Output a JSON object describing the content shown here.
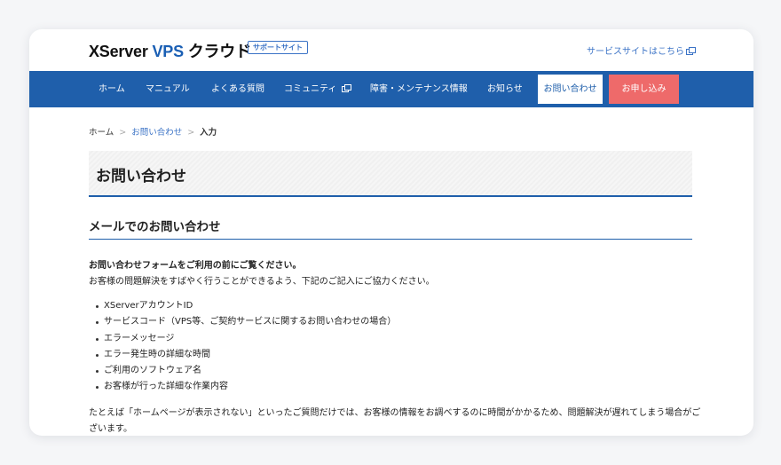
{
  "header": {
    "logo": {
      "part1": "XServer",
      "part2": "VPS",
      "part3": "クラウド"
    },
    "support_badge": "サポートサイト",
    "service_link": "サービスサイトはこちら"
  },
  "nav": {
    "items": [
      {
        "label": "ホーム"
      },
      {
        "label": "マニュアル"
      },
      {
        "label": "よくある質問"
      },
      {
        "label": "コミュニティ"
      },
      {
        "label": "障害・メンテナンス情報"
      },
      {
        "label": "お知らせ"
      }
    ],
    "contact": "お問い合わせ",
    "apply": "お申し込み"
  },
  "breadcrumb": {
    "home": "ホーム",
    "contact": "お問い合わせ",
    "current": "入力",
    "separator": ">"
  },
  "page": {
    "title": "お問い合わせ",
    "section_title": "メールでのお問い合わせ",
    "intro_bold": "お問い合わせフォームをご利用の前にご覧ください。",
    "intro": "お客様の問題解決をすばやく行うことができるよう、下記のご記入にご協力ください。",
    "list": [
      "XServerアカウントID",
      "サービスコード（VPS等、ご契約サービスに関するお問い合わせの場合）",
      "エラーメッセージ",
      "エラー発生時の詳細な時間",
      "ご利用のソフトウェア名",
      "お客様が行った詳細な作業内容"
    ],
    "note": "たとえば「ホームページが表示されない」といったご質問だけでは、お客様の情報をお調べするのに時間がかかるため、問題解決が遅れてしまう場合がございます。"
  },
  "colors": {
    "brand_blue": "#1f5fab",
    "apply_red": "#ee6a6a",
    "link_blue": "#3b73c6"
  }
}
